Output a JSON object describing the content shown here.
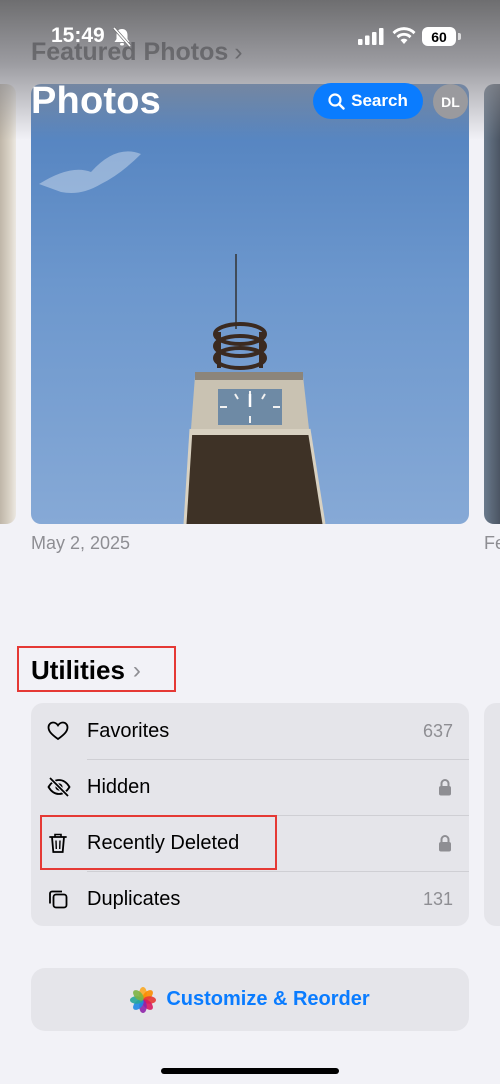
{
  "status_bar": {
    "time": "15:49",
    "battery": "60",
    "icons": [
      "bell-slash-icon",
      "cellular-signal-icon",
      "wifi-icon",
      "battery-icon"
    ]
  },
  "header": {
    "title": "Photos",
    "search_label": "Search",
    "avatar_initials": "DL",
    "accent_color": "#0a7cff"
  },
  "featured": {
    "title": "Featured Photos",
    "chevron": "›",
    "photo_date": "May 2, 2025",
    "next_photo_caption": "Fe"
  },
  "utilities": {
    "title": "Utilities",
    "chevron": "›",
    "items": [
      {
        "label": "Favorites",
        "value": "637",
        "icon": "heart-icon"
      },
      {
        "label": "Hidden",
        "value": "",
        "icon": "eye-slash-icon",
        "locked": true
      },
      {
        "label": "Recently Deleted",
        "value": "",
        "icon": "trash-icon",
        "locked": true
      },
      {
        "label": "Duplicates",
        "value": "131",
        "icon": "duplicates-icon"
      }
    ]
  },
  "customize": {
    "label": "Customize & Reorder",
    "icon": "photos-app-icon"
  },
  "annotations": {
    "highlight_color": "#e53935"
  }
}
